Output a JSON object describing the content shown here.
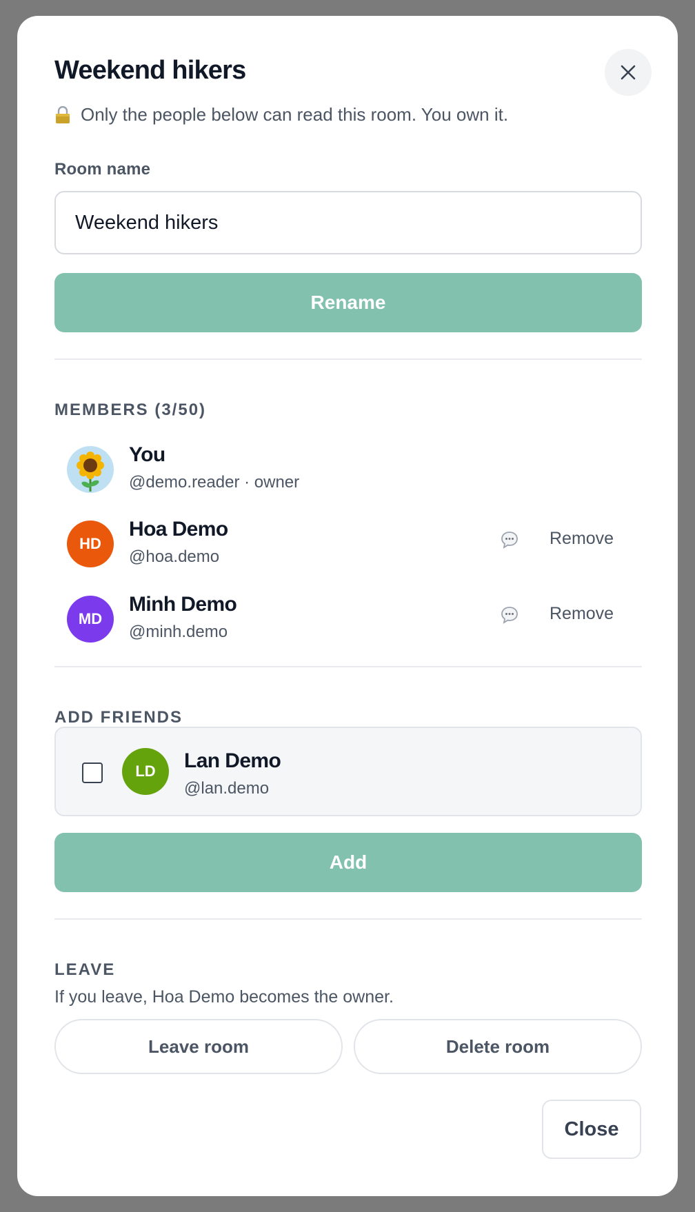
{
  "modal": {
    "title": "Weekend hikers",
    "subtitle_icon": "lock-icon",
    "subtitle": "Only the people below can read this room. You own it."
  },
  "rename": {
    "label": "Room name",
    "value": "Weekend hikers",
    "button": "Rename"
  },
  "members": {
    "heading": "MEMBERS (3/50)",
    "items": [
      {
        "name": "You",
        "handle": "@demo.reader · owner",
        "initials": "",
        "color": "#bfe0f2",
        "avatar_icon": "sunflower-icon"
      },
      {
        "name": "Hoa Demo",
        "handle": "@hoa.demo",
        "initials": "HD",
        "color": "#ea580c",
        "remove": "Remove"
      },
      {
        "name": "Minh Demo",
        "handle": "@minh.demo",
        "initials": "MD",
        "color": "#7c3aed",
        "remove": "Remove"
      }
    ]
  },
  "add_friends": {
    "heading": "ADD FRIENDS",
    "friend": {
      "name": "Lan Demo",
      "handle": "@lan.demo",
      "initials": "LD",
      "color": "#65a30d",
      "checked": false
    },
    "button": "Add"
  },
  "leave": {
    "heading": "LEAVE",
    "note": "If you leave, Hoa Demo becomes the owner.",
    "leave_button": "Leave room",
    "delete_button": "Delete room"
  },
  "footer": {
    "close_button": "Close"
  },
  "colors": {
    "primary": "#83c1af",
    "backdrop": "#7b7b7b"
  }
}
